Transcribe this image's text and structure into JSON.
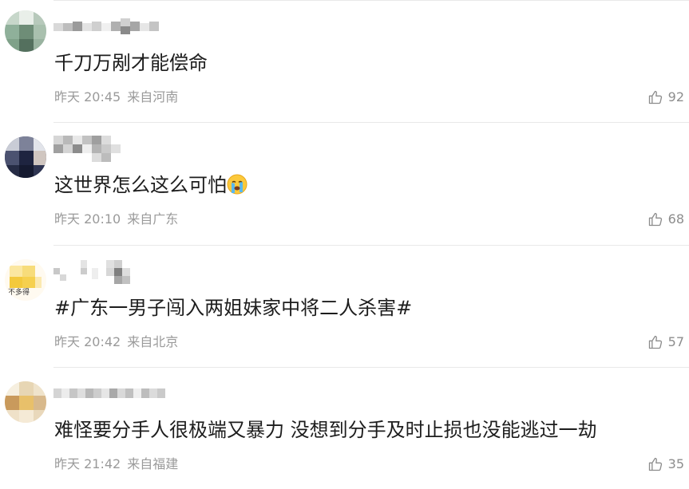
{
  "comments": [
    {
      "text": "千刀万剐才能偿命",
      "time": "昨天 20:45",
      "location": "来自河南",
      "likes": "92",
      "avatar_color": "#9cb8a4"
    },
    {
      "text": "这世界怎么这么可怕",
      "emoji": "crying-face-icon",
      "time": "昨天 20:10",
      "location": "来自广东",
      "likes": "68",
      "avatar_color": "#2b3350"
    },
    {
      "text": "#广东一男子闯入两姐妹家中将二人杀害#",
      "time": "昨天 20:42",
      "location": "来自北京",
      "likes": "57",
      "avatar_color": "#f4d35a",
      "avatar_caption": "不多得"
    },
    {
      "text": "难怪要分手人很极端又暴力 没想到分手及时止损也没能逃过一劫",
      "time": "昨天 21:42",
      "location": "来自福建",
      "likes": "35",
      "avatar_color": "#e9d2a9"
    }
  ],
  "icons": {
    "like": "thumbs-up-icon"
  }
}
